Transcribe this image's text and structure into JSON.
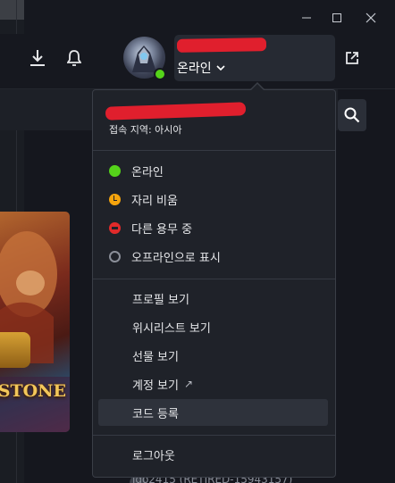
{
  "window": {
    "controls": [
      "minimize-icon",
      "maximize-icon",
      "close-icon"
    ]
  },
  "header": {
    "status_label": "온라인",
    "status_color": "#55d31a",
    "icons": [
      "download-icon",
      "bell-icon",
      "external-link-icon",
      "search-icon"
    ]
  },
  "game": {
    "logo_text": "STONE"
  },
  "dropdown": {
    "region": "접속 지역: 아시아",
    "statuses": [
      {
        "label": "온라인",
        "icon": "online-icon",
        "color": "#55d31a"
      },
      {
        "label": "자리 비움",
        "icon": "away-icon",
        "color": "#f5a40d"
      },
      {
        "label": "다른 용무 중",
        "icon": "busy-icon",
        "color": "#e02a2a"
      },
      {
        "label": "오프라인으로 표시",
        "icon": "offline-icon",
        "color": "#8a8e98"
      }
    ],
    "menu": [
      {
        "label": "프로필 보기"
      },
      {
        "label": "위시리스트 보기"
      },
      {
        "label": "선물 보기"
      },
      {
        "label": "계정 보기",
        "suffix": "↗"
      },
      {
        "label": "코드 등록"
      }
    ],
    "logout_label": "로그아웃"
  },
  "background": {
    "partial_username": "ido2415 (RETIRED-15943157)"
  }
}
